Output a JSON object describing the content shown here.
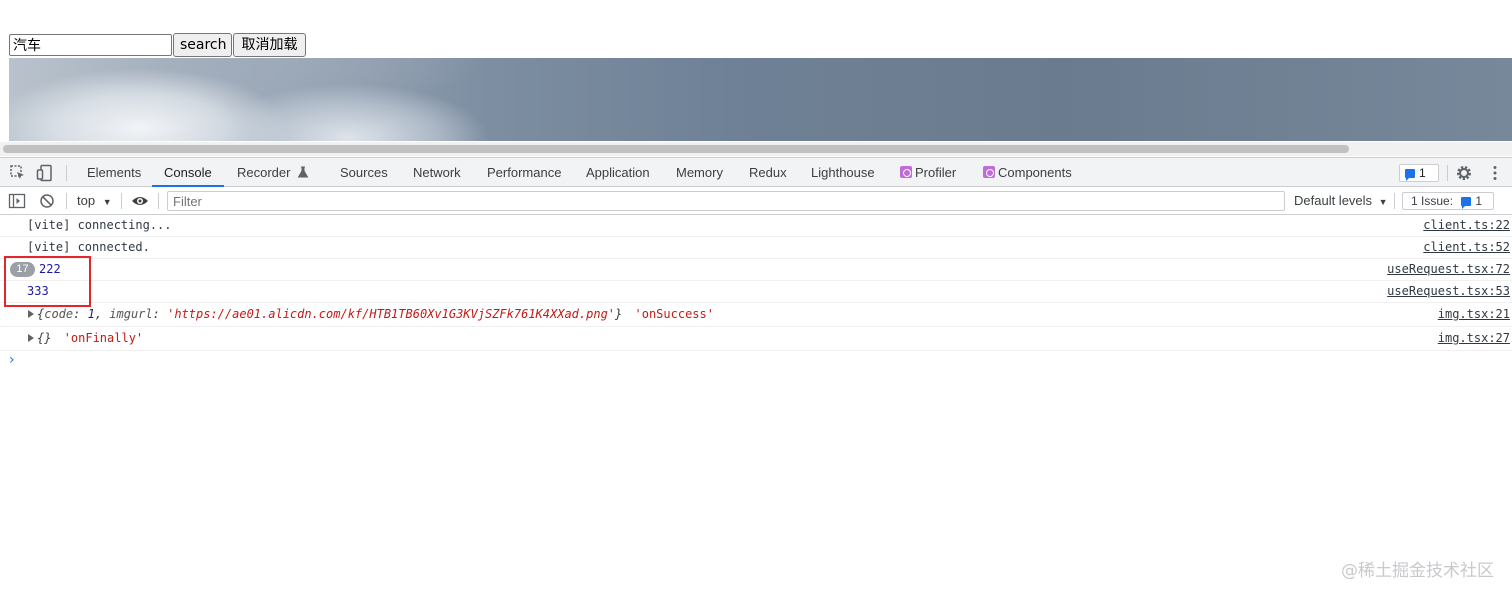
{
  "page": {
    "search_value": "汽车",
    "search_button": "search",
    "cancel_button": "取消加载"
  },
  "devtools": {
    "tabs": [
      "Elements",
      "Console",
      "Recorder",
      "Sources",
      "Network",
      "Performance",
      "Application",
      "Memory",
      "Redux",
      "Lighthouse",
      "Profiler",
      "Components"
    ],
    "active_tab": "Console",
    "issues_count": "1",
    "icons": [
      "inspect-icon",
      "device-toolbar-icon",
      "flask-icon",
      "gear-icon",
      "kebab-menu-icon",
      "sidebar-toggle-icon",
      "clear-console-icon",
      "eye-icon"
    ],
    "toolbar": {
      "context": "top",
      "filter_placeholder": "Filter",
      "levels": "Default levels",
      "issue_label": "1 Issue:",
      "issue_count": "1"
    },
    "logs": [
      {
        "text": "[vite] connecting...",
        "source": "client.ts:22"
      },
      {
        "text": "[vite] connected.",
        "source": "client.ts:52"
      },
      {
        "repeat": "17",
        "text": "222",
        "source": "useRequest.tsx:72"
      },
      {
        "text": "333",
        "source": "useRequest.tsx:53"
      },
      {
        "obj_open": "{",
        "key1": "code",
        "val1": "1",
        "key2": "imgurl",
        "val2": "'https://ae01.alicdn.com/kf/HTB1TB60Xv1G3KVjSZFk761K4XXad.png'",
        "obj_close": "}",
        "label": "'onSuccess'",
        "source": "img.tsx:21"
      },
      {
        "obj": "{}",
        "label": "'onFinally'",
        "source": "img.tsx:27"
      }
    ],
    "prompt": "›"
  },
  "colors": {
    "accent": "#1a73e8",
    "highlight_box": "#e0282c",
    "string": "#c41a16",
    "number": "#1a1aa6"
  },
  "watermark": "@稀土掘金技术社区"
}
